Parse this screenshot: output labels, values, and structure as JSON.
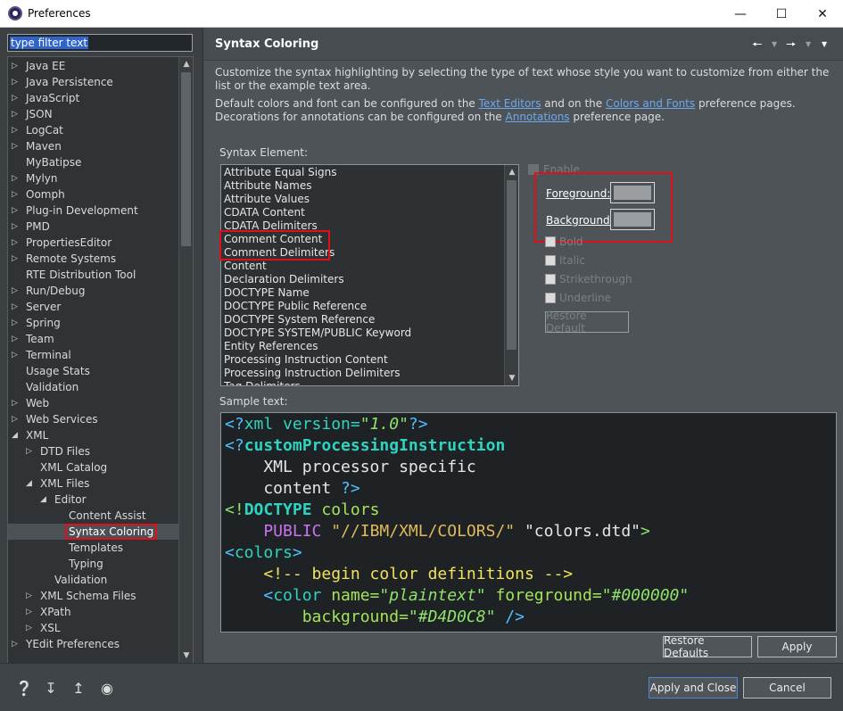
{
  "window": {
    "title": "Preferences"
  },
  "filter": {
    "text": "type filter text"
  },
  "tree": [
    {
      "label": "Java EE",
      "arrow": "▷",
      "depth": 0
    },
    {
      "label": "Java Persistence",
      "arrow": "▷",
      "depth": 0
    },
    {
      "label": "JavaScript",
      "arrow": "▷",
      "depth": 0
    },
    {
      "label": "JSON",
      "arrow": "▷",
      "depth": 0
    },
    {
      "label": "LogCat",
      "arrow": "▷",
      "depth": 0
    },
    {
      "label": "Maven",
      "arrow": "▷",
      "depth": 0
    },
    {
      "label": "MyBatipse",
      "arrow": "",
      "depth": 0
    },
    {
      "label": "Mylyn",
      "arrow": "▷",
      "depth": 0
    },
    {
      "label": "Oomph",
      "arrow": "▷",
      "depth": 0
    },
    {
      "label": "Plug-in Development",
      "arrow": "▷",
      "depth": 0
    },
    {
      "label": "PMD",
      "arrow": "▷",
      "depth": 0
    },
    {
      "label": "PropertiesEditor",
      "arrow": "▷",
      "depth": 0
    },
    {
      "label": "Remote Systems",
      "arrow": "▷",
      "depth": 0
    },
    {
      "label": "RTE Distribution Tool",
      "arrow": "",
      "depth": 0
    },
    {
      "label": "Run/Debug",
      "arrow": "▷",
      "depth": 0
    },
    {
      "label": "Server",
      "arrow": "▷",
      "depth": 0
    },
    {
      "label": "Spring",
      "arrow": "▷",
      "depth": 0
    },
    {
      "label": "Team",
      "arrow": "▷",
      "depth": 0
    },
    {
      "label": "Terminal",
      "arrow": "▷",
      "depth": 0
    },
    {
      "label": "Usage Stats",
      "arrow": "",
      "depth": 0
    },
    {
      "label": "Validation",
      "arrow": "",
      "depth": 0
    },
    {
      "label": "Web",
      "arrow": "▷",
      "depth": 0
    },
    {
      "label": "Web Services",
      "arrow": "▷",
      "depth": 0
    },
    {
      "label": "XML",
      "arrow": "◢",
      "depth": 0
    },
    {
      "label": "DTD Files",
      "arrow": "▷",
      "depth": 1
    },
    {
      "label": "XML Catalog",
      "arrow": "",
      "depth": 1
    },
    {
      "label": "XML Files",
      "arrow": "◢",
      "depth": 1
    },
    {
      "label": "Editor",
      "arrow": "◢",
      "depth": 2
    },
    {
      "label": "Content Assist",
      "arrow": "",
      "depth": 3
    },
    {
      "label": "Syntax Coloring",
      "arrow": "",
      "depth": 3,
      "selected": true
    },
    {
      "label": "Templates",
      "arrow": "",
      "depth": 3
    },
    {
      "label": "Typing",
      "arrow": "",
      "depth": 3
    },
    {
      "label": "Validation",
      "arrow": "",
      "depth": 2
    },
    {
      "label": "XML Schema Files",
      "arrow": "▷",
      "depth": 1
    },
    {
      "label": "XPath",
      "arrow": "▷",
      "depth": 1
    },
    {
      "label": "XSL",
      "arrow": "▷",
      "depth": 1
    },
    {
      "label": "YEdit Preferences",
      "arrow": "▷",
      "depth": 0
    }
  ],
  "page": {
    "title": "Syntax Coloring",
    "desc1": "Customize the syntax highlighting by selecting the type of text whose style you want to customize from either the list or the example text area.",
    "desc2_a": "Default colors and font can be configured on the ",
    "link_text_editors": "Text Editors",
    "desc2_b": " and on the ",
    "link_colors_fonts": "Colors and Fonts",
    "desc2_c": " preference pages.  Decorations for annotations can be configured on the ",
    "link_annotations": "Annotations",
    "desc2_d": " preference page.",
    "syntax_label": "Syntax Element:",
    "sample_label": "Sample text:"
  },
  "elements": [
    "Attribute Equal Signs",
    "Attribute Names",
    "Attribute Values",
    "CDATA Content",
    "CDATA Delimiters",
    "Comment Content",
    "Comment Delimiters",
    "Content",
    "Declaration Delimiters",
    "DOCTYPE Name",
    "DOCTYPE Public Reference",
    "DOCTYPE System Reference",
    "DOCTYPE SYSTEM/PUBLIC Keyword",
    "Entity References",
    "Processing Instruction Content",
    "Processing Instruction Delimiters",
    "Tag Delimiters"
  ],
  "options": {
    "enable": "Enable",
    "foreground": "Foreground:",
    "background": "Background:",
    "bold": "Bold",
    "italic": "Italic",
    "strikethrough": "Strikethrough",
    "underline": "Underline",
    "restore_default": "Restore Default"
  },
  "sample_lines": [
    [
      {
        "t": "<?",
        "c": "#4fc1ff"
      },
      {
        "t": "xml version=",
        "c": "#2dd4bf"
      },
      {
        "t": "\"1.0\"",
        "c": "#8fe36b",
        "i": true
      },
      {
        "t": "?>",
        "c": "#4fc1ff"
      }
    ],
    [
      {
        "t": "<?",
        "c": "#4fc1ff"
      },
      {
        "t": "customProcessingInstruction",
        "c": "#2dd4bf",
        "b": true
      }
    ],
    [
      {
        "t": "    XML processor specific",
        "c": "#e6e6e6"
      }
    ],
    [
      {
        "t": "    content ",
        "c": "#e6e6e6"
      },
      {
        "t": "?>",
        "c": "#4fc1ff"
      }
    ],
    [
      {
        "t": "<!",
        "c": "#8fe36b"
      },
      {
        "t": "DOCTYPE",
        "c": "#2dd4bf",
        "b": true
      },
      {
        "t": " colors",
        "c": "#a4e35a"
      }
    ],
    [
      {
        "t": "    PUBLIC ",
        "c": "#c973f2"
      },
      {
        "t": "\"//IBM/XML/COLORS/\"",
        "c": "#e0b95a"
      },
      {
        "t": " \"colors.dtd\"",
        "c": "#e6e6e6"
      },
      {
        "t": ">",
        "c": "#8fe36b"
      }
    ],
    [
      {
        "t": "<",
        "c": "#4fc1ff"
      },
      {
        "t": "colors",
        "c": "#2dd4bf"
      },
      {
        "t": ">",
        "c": "#4fc1ff"
      }
    ],
    [
      {
        "t": "    <!-- begin color definitions -->",
        "c": "#f2e35a"
      }
    ],
    [
      {
        "t": "    <",
        "c": "#4fc1ff"
      },
      {
        "t": "color",
        "c": "#2dd4bf"
      },
      {
        "t": " name=",
        "c": "#a4e35a"
      },
      {
        "t": "\"plaintext\"",
        "c": "#8fe36b",
        "i": true
      },
      {
        "t": " foreground=",
        "c": "#a4e35a"
      },
      {
        "t": "\"#000000\"",
        "c": "#8fe36b",
        "i": true
      }
    ],
    [
      {
        "t": "        background=",
        "c": "#a4e35a"
      },
      {
        "t": "\"#D4D0C8\"",
        "c": "#8fe36b",
        "i": true
      },
      {
        "t": " />",
        "c": "#4fc1ff"
      }
    ]
  ],
  "buttons": {
    "restore_defaults": "Restore Defaults",
    "apply": "Apply",
    "apply_close": "Apply and Close",
    "cancel": "Cancel"
  }
}
